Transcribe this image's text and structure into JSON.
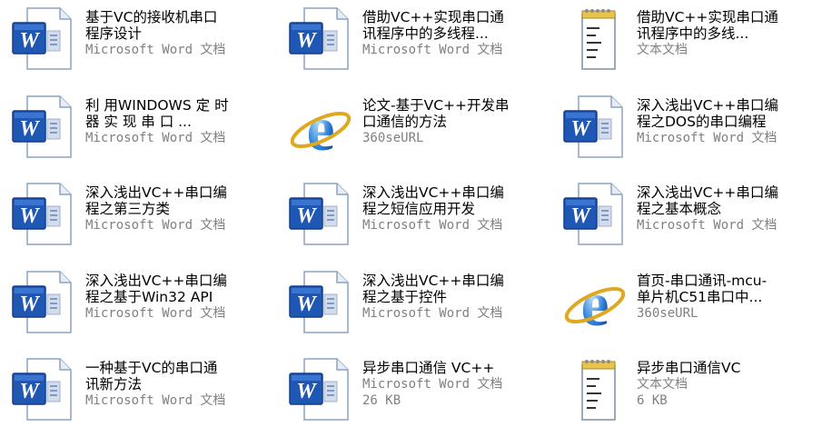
{
  "files": [
    {
      "line1": "基于VC的接收机串口",
      "line2": "程序设计",
      "type": "Microsoft Word 文档",
      "size": "",
      "icon": "word-document-icon"
    },
    {
      "line1": "借助VC++实现串口通",
      "line2": "讯程序中的多线程...",
      "type": "Microsoft Word 文档",
      "size": "",
      "icon": "word-document-icon"
    },
    {
      "line1": "借助VC++实现串口通",
      "line2": "讯程序中的多线...",
      "type": "文本文档",
      "size": "",
      "icon": "text-document-icon"
    },
    {
      "line1": "利 用WINDOWS 定 时",
      "line2": "器 实 现 串 口 ...",
      "type": "Microsoft Word 文档",
      "size": "",
      "icon": "word-document-icon"
    },
    {
      "line1": "论文-基于VC++开发串",
      "line2": "口通信的方法",
      "type": "360seURL",
      "size": "",
      "icon": "internet-shortcut-icon"
    },
    {
      "line1": "深入浅出VC++串口编",
      "line2": "程之DOS的串口编程",
      "type": "Microsoft Word 文档",
      "size": "",
      "icon": "word-document-icon"
    },
    {
      "line1": "深入浅出VC++串口编",
      "line2": "程之第三方类",
      "type": "Microsoft Word 文档",
      "size": "",
      "icon": "word-document-icon"
    },
    {
      "line1": "深入浅出VC++串口编",
      "line2": "程之短信应用开发",
      "type": "Microsoft Word 文档",
      "size": "",
      "icon": "word-document-icon"
    },
    {
      "line1": "深入浅出VC++串口编",
      "line2": "程之基本概念",
      "type": "Microsoft Word 文档",
      "size": "",
      "icon": "word-document-icon"
    },
    {
      "line1": "深入浅出VC++串口编",
      "line2": "程之基于Win32 API",
      "type": "Microsoft Word 文档",
      "size": "",
      "icon": "word-document-icon"
    },
    {
      "line1": "深入浅出VC++串口编",
      "line2": "程之基于控件",
      "type": "Microsoft Word 文档",
      "size": "",
      "icon": "word-document-icon"
    },
    {
      "line1": "首页-串口通讯-mcu-",
      "line2": "单片机C51串口中...",
      "type": "360seURL",
      "size": "",
      "icon": "internet-shortcut-icon"
    },
    {
      "line1": "一种基于VC的串口通",
      "line2": "讯新方法",
      "type": "Microsoft Word 文档",
      "size": "",
      "icon": "word-document-icon"
    },
    {
      "line1": "异步串口通信 VC++",
      "line2": "",
      "type": "Microsoft Word 文档",
      "size": "26 KB",
      "icon": "word-document-icon"
    },
    {
      "line1": "异步串口通信VC",
      "line2": "",
      "type": "文本文档",
      "size": "6 KB",
      "icon": "text-document-icon"
    }
  ]
}
